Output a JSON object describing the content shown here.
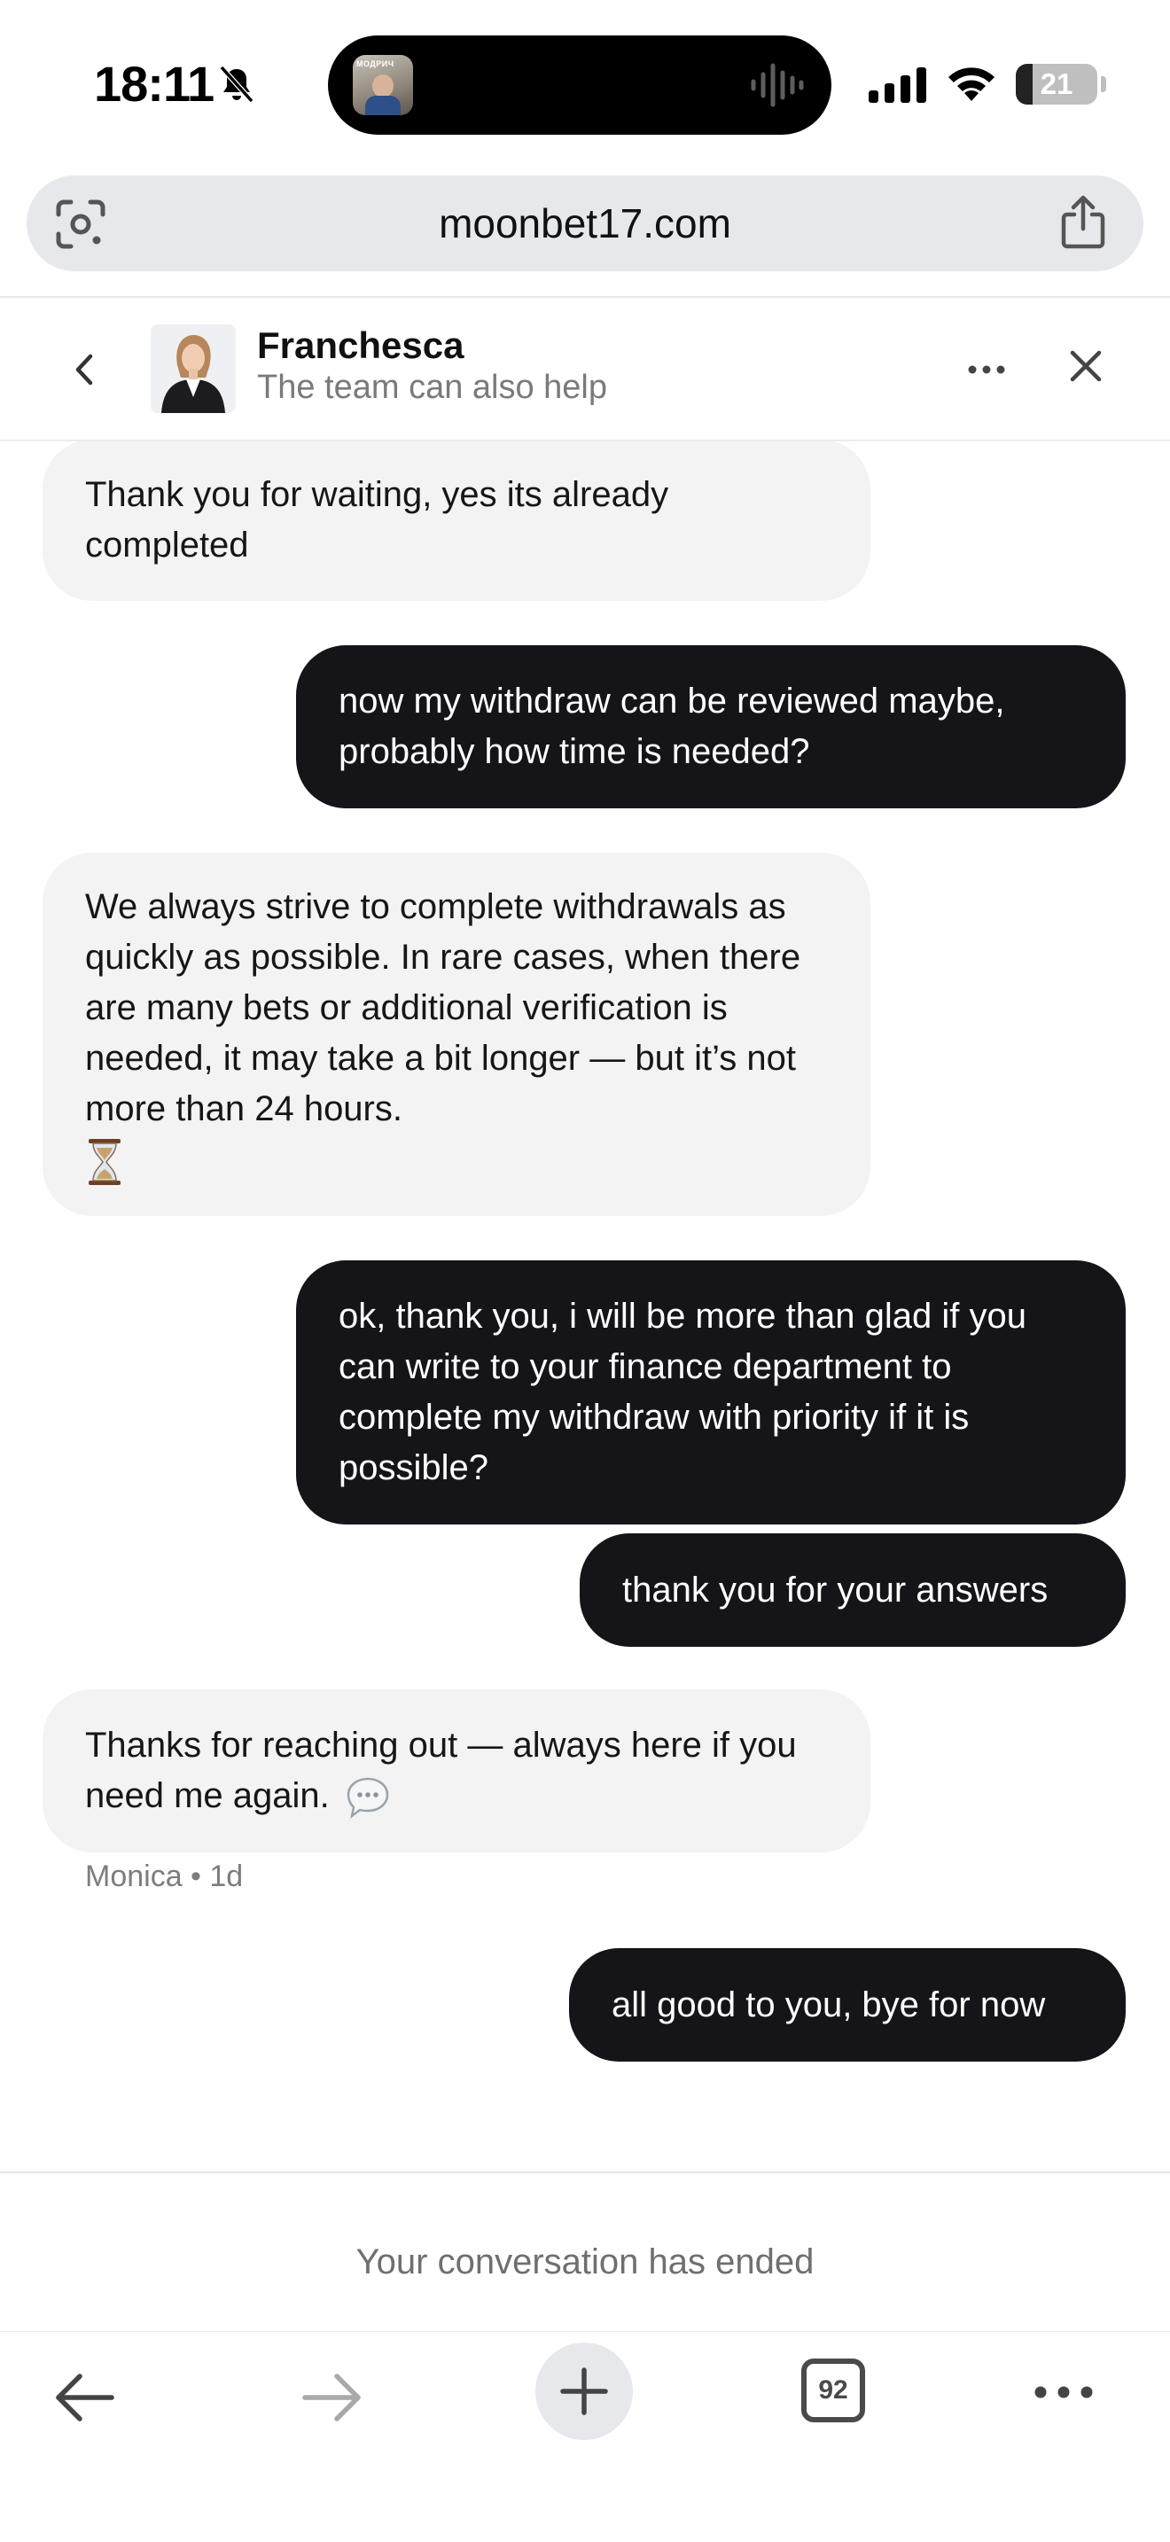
{
  "status_bar": {
    "time": "18:11",
    "battery": "21",
    "battery_fraction": 0.21,
    "island_thumb_text": "МОДРИЧ"
  },
  "browser": {
    "url": "moonbet17.com",
    "tab_count": "92"
  },
  "chat_header": {
    "agent_name": "Franchesca",
    "subtitle": "The team can also help"
  },
  "messages": [
    {
      "sender": "agent",
      "text": "Thank you for waiting, yes its already completed"
    },
    {
      "sender": "user",
      "text": "now my withdraw can be reviewed maybe, probably how time is needed?"
    },
    {
      "sender": "agent",
      "text": "We always strive to complete withdrawals as quickly as possible. In rare cases, when there are many bets or additional verification is needed, it may take a bit longer — but it’s not more than 24 hours.",
      "emoji": "hourglass-icon"
    },
    {
      "sender": "user",
      "text": "ok, thank you, i will be more than glad if you can write to your finance department to complete my withdraw with priority if it is possible?"
    },
    {
      "sender": "user",
      "text": "thank you for your answers"
    },
    {
      "sender": "agent",
      "text": "Thanks for reaching out — always here if you need me again.",
      "emoji": "speech-bubble-icon"
    },
    {
      "sender": "user",
      "text": "all good to you, bye for now"
    }
  ],
  "message_meta": "Monica • 1d",
  "conversation_ended": "Your conversation has ended",
  "colors": {
    "user_bubble": "#151519",
    "agent_bubble": "#f3f3f3",
    "url_bar": "#e6e8ec"
  }
}
